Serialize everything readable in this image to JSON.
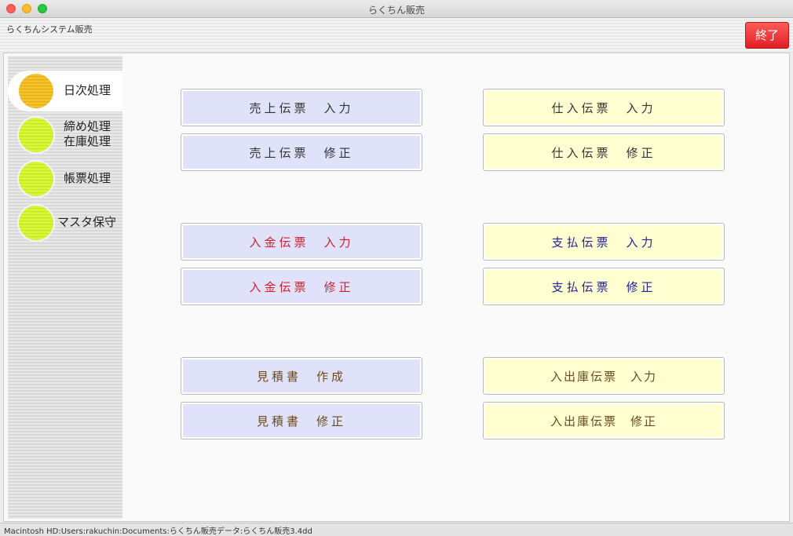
{
  "window": {
    "title": "らくちん販売"
  },
  "header": {
    "app_label": "らくちんシステム販売",
    "quit_label": "終了",
    "quit_color": "#e01e24"
  },
  "sidebar": {
    "items": [
      {
        "label": "日次処理",
        "active": true,
        "icon": "orange-circle-icon"
      },
      {
        "label_line1": "締め処理",
        "label_line2": "在庫処理",
        "active": false,
        "icon": "green-circle-icon"
      },
      {
        "label": "帳票処理",
        "active": false,
        "icon": "green-circle-icon"
      },
      {
        "label": "マスタ保守",
        "active": false,
        "icon": "green-circle-icon"
      }
    ]
  },
  "buttons": {
    "sales_slip_input": "売上伝票　入力",
    "sales_slip_edit": "売上伝票　修正",
    "purchase_slip_input": "仕入伝票　入力",
    "purchase_slip_edit": "仕入伝票　修正",
    "receipt_slip_input": "入金伝票　入力",
    "receipt_slip_edit": "入金伝票　修正",
    "payment_slip_input": "支払伝票　入力",
    "payment_slip_edit": "支払伝票　修正",
    "estimate_create": "見積書　作成",
    "estimate_edit": "見積書　修正",
    "stock_slip_input": "入出庫伝票　入力",
    "stock_slip_edit": "入出庫伝票　修正"
  },
  "colors": {
    "blue_button_bg": "#e0e2fa",
    "yellow_button_bg": "#ffffd2",
    "receipt_text": "#d41e2c",
    "payment_text": "#22229a",
    "stock_text": "#6b4a1e"
  },
  "status": {
    "path": "Macintosh HD:Users:rakuchin:Documents:らくちん販売データ:らくちん販売3.4dd"
  }
}
